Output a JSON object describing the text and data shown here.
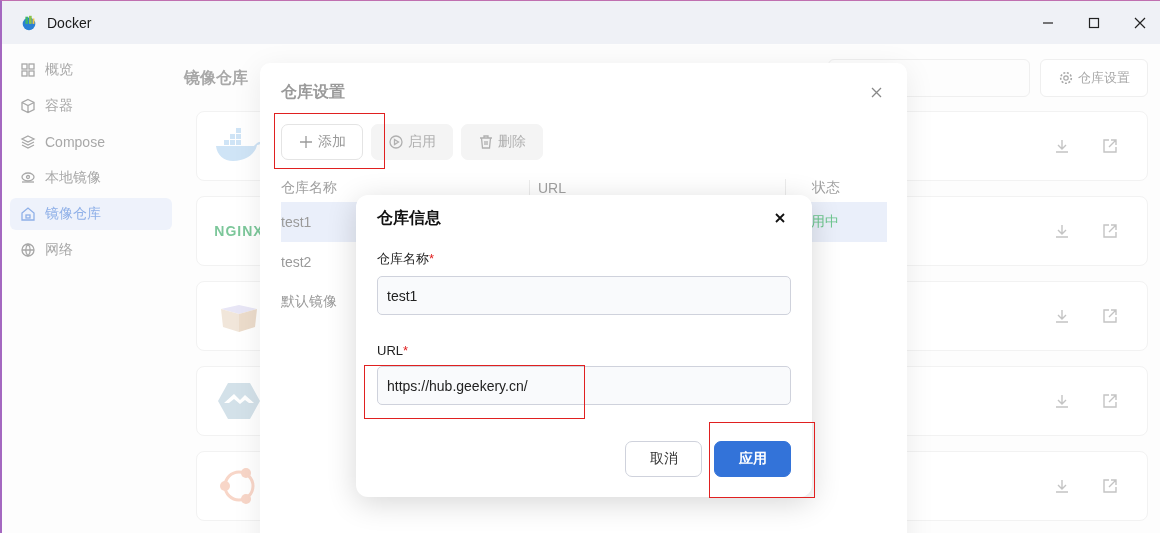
{
  "window": {
    "title": "Docker"
  },
  "sidebar": {
    "items": [
      {
        "label": "概览",
        "selected": false
      },
      {
        "label": "容器",
        "selected": false
      },
      {
        "label": "Compose",
        "selected": false
      },
      {
        "label": "本地镜像",
        "selected": false
      },
      {
        "label": "镜像仓库",
        "selected": true
      },
      {
        "label": "网络",
        "selected": false
      }
    ]
  },
  "page": {
    "title": "镜像仓库",
    "settings_button": "仓库设置",
    "cards": [
      {
        "kind": "whale"
      },
      {
        "kind": "wordmark",
        "text": "NGINX"
      },
      {
        "kind": "box"
      },
      {
        "kind": "hexagon"
      },
      {
        "kind": "ring"
      }
    ]
  },
  "settings_dialog": {
    "title": "仓库设置",
    "toolbar": [
      {
        "label": "添加",
        "disabled": false
      },
      {
        "label": "启用",
        "disabled": true
      },
      {
        "label": "删除",
        "disabled": true
      }
    ],
    "columns": [
      "仓库名称",
      "URL",
      "状态"
    ],
    "rows": [
      {
        "name": "test1",
        "status": "用中",
        "selected": true
      },
      {
        "name": "test2",
        "selected": false
      },
      {
        "name": "默认镜像",
        "selected": false
      }
    ]
  },
  "info_dialog": {
    "title": "仓库信息",
    "fields": [
      {
        "label": "仓库名称",
        "required_mark": "*",
        "value": "test1"
      },
      {
        "label": "URL",
        "required_mark": "*",
        "value": "https://hub.geekery.cn/"
      }
    ],
    "buttons": [
      {
        "label": "取消",
        "kind": "secondary"
      },
      {
        "label": "应用",
        "kind": "primary"
      }
    ]
  }
}
